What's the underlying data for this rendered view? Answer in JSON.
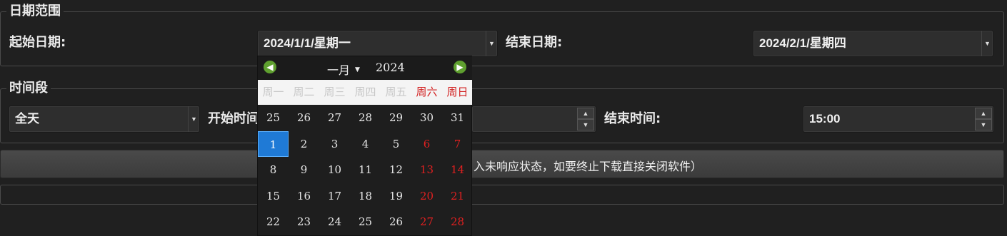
{
  "date_range": {
    "title": "日期范围",
    "start_label": "起始日期:",
    "start_value": "2024/1/1/星期一",
    "end_label": "结束日期:",
    "end_value": "2024/2/1/星期四"
  },
  "time_period": {
    "title": "时间段",
    "preset_value": "全天",
    "start_label": "开始时间",
    "end_label": "结束时间:",
    "end_value": "15:00"
  },
  "progress": {
    "text": "入未响应状态，如要终止下载直接关闭软件）"
  },
  "calendar": {
    "month": "一月",
    "year": "2024",
    "weekdays": [
      "周一",
      "周二",
      "周三",
      "周四",
      "周五",
      "周六",
      "周日"
    ],
    "weeks": [
      [
        "25",
        "26",
        "27",
        "28",
        "29",
        "30",
        "31"
      ],
      [
        "1",
        "2",
        "3",
        "4",
        "5",
        "6",
        "7"
      ],
      [
        "8",
        "9",
        "10",
        "11",
        "12",
        "13",
        "14"
      ],
      [
        "15",
        "16",
        "17",
        "18",
        "19",
        "20",
        "21"
      ],
      [
        "22",
        "23",
        "24",
        "25",
        "26",
        "27",
        "28"
      ]
    ],
    "selected": "1",
    "icons": {
      "prev": "arrow-left-icon",
      "next": "arrow-right-icon",
      "month_dropdown": "triangle-down-icon"
    },
    "colors": {
      "weekend": "#e02020",
      "selected": "#1f7ad6",
      "nav": "#5fa02f"
    }
  }
}
